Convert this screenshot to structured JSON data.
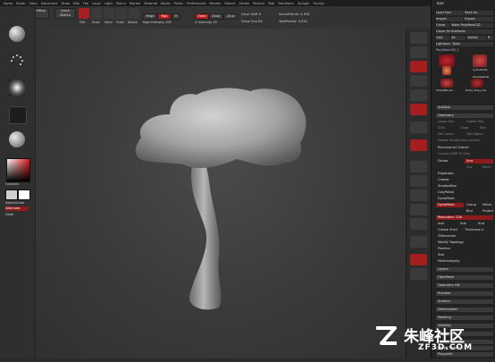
{
  "menu": {
    "items": [
      "Alpha",
      "Brush",
      "Color",
      "Document",
      "Draw",
      "Edit",
      "File",
      "Layer",
      "Light",
      "Macro",
      "Marker",
      "Material",
      "Movie",
      "Picker",
      "Preferences",
      "Render",
      "Stencil",
      "Stroke",
      "Texture",
      "Tool",
      "Transform",
      "Zplugin",
      "Zscript"
    ]
  },
  "toolbar": {
    "projection_master": "Projection Master",
    "lightbox": "LightBox",
    "quick_sketch": "Quick Sketch",
    "edit": "Edit",
    "draw": "Draw",
    "move": "Move",
    "scale": "Scale",
    "rotate": "Rotate",
    "mrgb": "Mrgb",
    "rgb": "Rgb",
    "m": "M",
    "zadd": "Zadd",
    "zsub": "Zsub",
    "zcut": "Zcut",
    "rgb_intensity": "Rgb Intensity 100",
    "z_intensity": "Z Intensity 25",
    "focal_shift": "Focal Shift 0",
    "draw_size": "Draw Size 64",
    "active_points": "ActivePoints: 4,934",
    "total_points": "TotalPoints: 4,934"
  },
  "left_shelf": {
    "gradient_label": "Gradient",
    "switch_color": "SwitchColor",
    "alternate": "Alternate",
    "clear": "Clear",
    "primary_color": "#cfcfcf",
    "secondary_color": "#ffffff"
  },
  "tool_panel": {
    "title": "Tool",
    "load_tool": "Load Tool",
    "save_as": "Save As",
    "import": "Import",
    "export": "Export",
    "clone": "Clone",
    "make_polymesh": "Make PolyMesh3D",
    "clone_all_subtools": "Clone All SubTools",
    "goz": "GoZ",
    "all": "All",
    "visible": "Visible",
    "r": "R",
    "lightbox_tools": "Lightbox› Tools",
    "tool_name": "PolyMesh3D_1",
    "thumb_1_label": "Cylinder3D",
    "thumb_2_label": "PolyMesh3D",
    "thumb_3_label": "SimpleBrush",
    "thumb_4_label": "Extra_Tree_Low",
    "subtool": "SubTool",
    "geometry": "Geometry",
    "lower_res": "Lower Res",
    "higher_res": "Higher Res",
    "sdiv": "SDiv",
    "cage": "Cage",
    "rstr": "Rstr",
    "del_lower": "Del Lower",
    "del_higher": "Del Higher",
    "freeze_subdiv": "Freeze SubDivision Levels",
    "reconstruct_subdiv": "Reconstruct Subdiv",
    "convert_bpr": "Convert BPR To Geo",
    "divide": "Divide",
    "smt": "Smt",
    "suv": "Suv",
    "reuv": "ReUV",
    "edgeloop": "EdgeLoop",
    "crease": "Crease",
    "shadowbox": "ShadowBox",
    "claypolish": "ClayPolish",
    "dynamesh": "DynaMesh",
    "dynamesh_btn": "DynaMesh",
    "group": "Group",
    "polish": "Polish",
    "blur": "Blur",
    "project": "Project",
    "resolution": "Resolution 128",
    "add": "Add",
    "sub": "Sub",
    "and": "And",
    "create_shell": "Create Shell",
    "thickness": "Thickness 4",
    "zremesher": "ZRemesher",
    "modify_topology": "Modify Topology",
    "position": "Position",
    "size": "Size",
    "meshintegrity": "MeshIntegrity",
    "layers": "Layers",
    "fibermesh": "FiberMesh",
    "geometry_hd": "Geometry HD",
    "preview": "Preview",
    "surface": "Surface",
    "deformation": "Deformation",
    "masking": "Masking",
    "visibility": "Visibility",
    "polygroups": "Polygroups",
    "contact": "Contact",
    "morph_target": "Morph Target",
    "polypaint": "Polypaint"
  },
  "watermark": {
    "site_name": "朱峰社区",
    "domain": "ZF3D.COM"
  }
}
